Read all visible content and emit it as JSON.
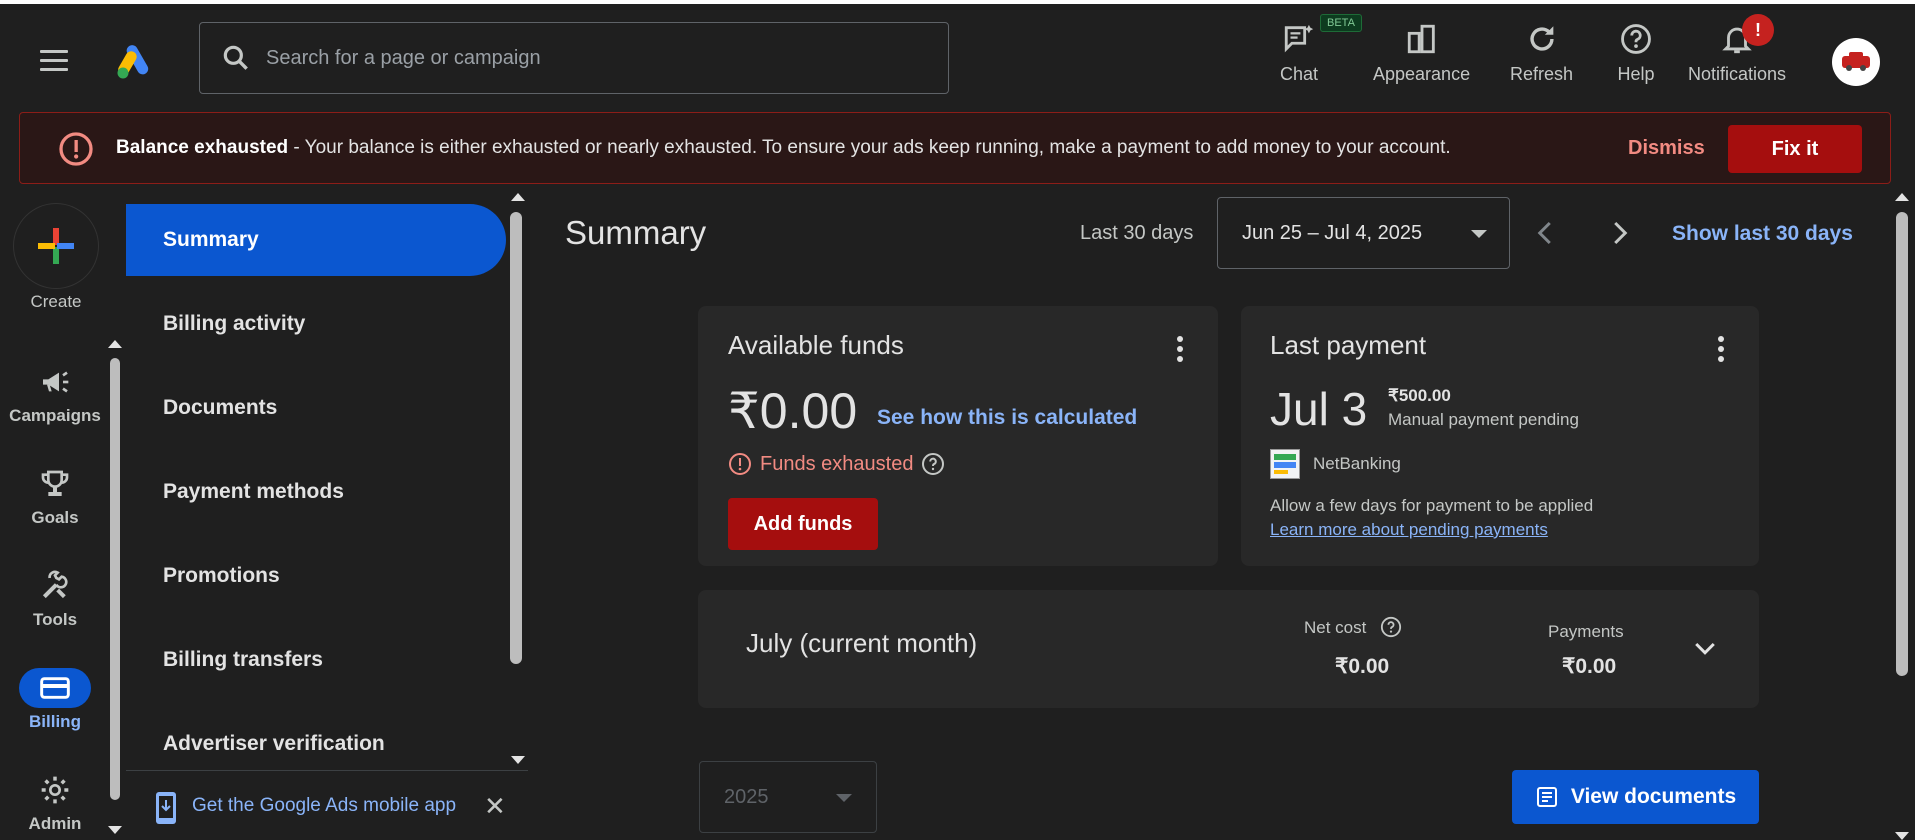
{
  "header": {
    "search_placeholder": "Search for a page or campaign",
    "actions": {
      "chat": "Chat",
      "chat_badge": "BETA",
      "appearance": "Appearance",
      "refresh": "Refresh",
      "help": "Help",
      "notifications": "Notifications",
      "notifications_badge": "!"
    }
  },
  "banner": {
    "title": "Balance exhausted",
    "message": " - Your balance is either exhausted or nearly exhausted. To ensure your ads keep running, make a payment to add money to your account.",
    "dismiss": "Dismiss",
    "fix": "Fix it"
  },
  "rail": {
    "create": "Create",
    "items": [
      "Campaigns",
      "Goals",
      "Tools",
      "Billing",
      "Admin"
    ],
    "active": "Billing"
  },
  "subnav": {
    "items": [
      "Summary",
      "Billing activity",
      "Documents",
      "Payment methods",
      "Promotions",
      "Billing transfers",
      "Advertiser verification"
    ],
    "active": "Summary",
    "promo": "Get the Google Ads mobile app"
  },
  "main": {
    "title": "Summary",
    "range_label": "Last 30 days",
    "date_range": "Jun 25 – Jul 4, 2025",
    "show_last": "Show last 30 days",
    "available_funds": {
      "title": "Available funds",
      "value": "₹0.00",
      "calc_link": "See how this is calculated",
      "status": "Funds exhausted",
      "add_funds": "Add funds"
    },
    "last_payment": {
      "title": "Last payment",
      "date": "Jul 3",
      "amount": "₹500.00",
      "status": "Manual payment pending",
      "method": "NetBanking",
      "note": "Allow a few days for payment to be applied",
      "link": "Learn more about pending payments"
    },
    "month": {
      "title": "July (current month)",
      "net_cost_label": "Net cost",
      "net_cost_value": "₹0.00",
      "payments_label": "Payments",
      "payments_value": "₹0.00"
    },
    "year": "2025",
    "view_documents": "View documents"
  },
  "colors": {
    "accent": "#0b57d0",
    "link": "#8ab4f8",
    "danger": "#a50e0e",
    "danger_text": "#f28b82",
    "background": "#1f1f1f",
    "card": "#282828"
  }
}
